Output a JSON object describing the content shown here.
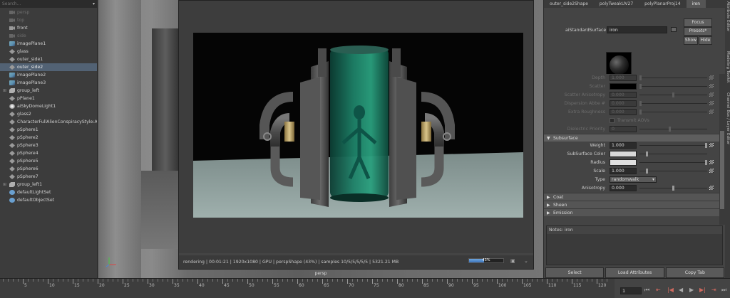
{
  "outliner": {
    "search_placeholder": "Search...",
    "items": [
      {
        "label": "persp",
        "icon": "camera-icon",
        "dim": true
      },
      {
        "label": "top",
        "icon": "camera-icon",
        "dim": true
      },
      {
        "label": "front",
        "icon": "camera-icon",
        "dim": false
      },
      {
        "label": "side",
        "icon": "camera-icon",
        "dim": true
      },
      {
        "label": "imagePlane1",
        "icon": "image-plane-icon"
      },
      {
        "label": "glass",
        "icon": "mesh-icon"
      },
      {
        "label": "outer_side1",
        "icon": "mesh-icon"
      },
      {
        "label": "outer_side2",
        "icon": "mesh-icon",
        "selected": true
      },
      {
        "label": "imagePlane2",
        "icon": "image-plane-icon"
      },
      {
        "label": "imagePlane3",
        "icon": "image-plane-icon"
      },
      {
        "label": "group_left",
        "icon": "group-icon",
        "expand": true
      },
      {
        "label": "pPlane1",
        "icon": "mesh-icon"
      },
      {
        "label": "aiSkyDomeLight1",
        "icon": "light-icon"
      },
      {
        "label": "glass2",
        "icon": "mesh-icon"
      },
      {
        "label": "CharacterFullAlienConspiracyStyle:Ali",
        "icon": "mesh-icon"
      },
      {
        "label": "pSphere1",
        "icon": "mesh-icon"
      },
      {
        "label": "pSphere2",
        "icon": "mesh-icon"
      },
      {
        "label": "pSphere3",
        "icon": "mesh-icon"
      },
      {
        "label": "pSphere4",
        "icon": "mesh-icon"
      },
      {
        "label": "pSphere5",
        "icon": "mesh-icon"
      },
      {
        "label": "pSphere6",
        "icon": "mesh-icon"
      },
      {
        "label": "pSphere7",
        "icon": "mesh-icon"
      },
      {
        "label": "group_left1",
        "icon": "group-icon",
        "expand": true
      },
      {
        "label": "defaultLightSet",
        "icon": "set-icon"
      },
      {
        "label": "defaultObjectSet",
        "icon": "set-icon"
      }
    ]
  },
  "viewport": {
    "camera_label": "persp"
  },
  "render_view": {
    "status": "rendering | 00:01:21 | 1920x1080 | GPU | perspShape (43%) | samples 10/5/5/5/5/5 | 5321.21 MB",
    "progress_percent": 43,
    "progress_label": "43%"
  },
  "attribute_editor": {
    "tabs": [
      "outer_side2Shape",
      "polyTweakUV27",
      "polyPlanarProj14",
      "iron"
    ],
    "active_tab": 3,
    "type_label": "aiStandardSurface:",
    "material_name": "iron",
    "buttons": {
      "focus": "Focus",
      "presets": "Presets*",
      "show": "Show",
      "hide": "Hide"
    },
    "rows_top": [
      {
        "label": "Depth",
        "value": "1.000",
        "dim": true,
        "thumb": 0.0
      },
      {
        "label": "Scatter",
        "color": "#000000",
        "dim": true,
        "thumb": 0.0
      },
      {
        "label": "Scatter Anisotropy",
        "value": "0.000",
        "dim": true,
        "thumb": 0.5
      },
      {
        "label": "Dispersion Abbe #",
        "value": "0.000",
        "dim": true,
        "thumb": 0.0
      },
      {
        "label": "Extra Roughness",
        "value": "0.000",
        "dim": true,
        "thumb": 0.0
      }
    ],
    "transmit_aovs": "Transmit AOVs",
    "dielectric_priority": {
      "label": "Dielectric Priority",
      "value": "0",
      "thumb": 0.45
    },
    "subsurface": {
      "title": "Subsurface",
      "weight": {
        "label": "Weight",
        "value": "1.000",
        "thumb": 1.0
      },
      "color_label": "SubSurface Color",
      "color": "#d9d9d9",
      "radius": {
        "label": "Radius",
        "color": "#e0e0e0",
        "thumb": 1.0
      },
      "scale": {
        "label": "Scale",
        "value": "1.000",
        "thumb": 0.1
      },
      "type_label": "Type",
      "type_value": "randomwalk",
      "anisotropy": {
        "label": "Anisotropy",
        "value": "0.000",
        "thumb": 0.5
      }
    },
    "sections": [
      "Coat",
      "Sheen",
      "Emission"
    ],
    "notes_label": "Notes:",
    "notes_value": "iron",
    "bottom_buttons": [
      "Select",
      "Load Attributes",
      "Copy Tab"
    ]
  },
  "side_tabs": [
    "Attribute Editor",
    "Modeling Toolkit",
    "Channel Box / Layer Editor"
  ],
  "timeline": {
    "ticks": [
      5,
      10,
      15,
      20,
      25,
      30,
      35,
      40,
      45,
      50,
      55,
      60,
      65,
      70,
      75,
      80,
      85,
      90,
      95,
      100,
      105,
      110,
      115,
      120
    ],
    "current_frame": "1"
  },
  "colors": {
    "accent": "#526274",
    "progress": "#3d74ba"
  }
}
